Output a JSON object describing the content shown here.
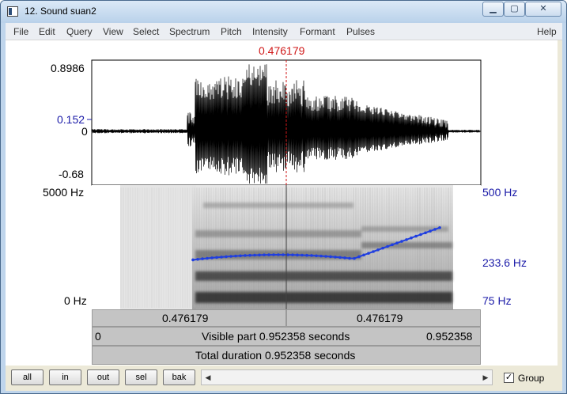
{
  "window": {
    "title": "12. Sound suan2"
  },
  "menu": [
    "File",
    "Edit",
    "Query",
    "View",
    "Select",
    "Spectrum",
    "Pitch",
    "Intensity",
    "Formant",
    "Pulses",
    "Help"
  ],
  "cursor": {
    "time_label": "0.476179",
    "time": 0.476179
  },
  "waveform": {
    "y_max": "0.8986",
    "y_zero": "0",
    "y_min": "-0.68",
    "y_marker": "0.152"
  },
  "spectrogram": {
    "freq_top": "5000 Hz",
    "freq_bottom": "0 Hz"
  },
  "pitch": {
    "top": "500 Hz",
    "current": "233.6 Hz",
    "bottom": "75 Hz"
  },
  "bars": {
    "left_segment": "0.476179",
    "right_segment": "0.476179",
    "visible_start": "0",
    "visible_label": "Visible part 0.952358 seconds",
    "visible_end": "0.952358",
    "total_label": "Total duration 0.952358 seconds"
  },
  "buttons": {
    "all": "all",
    "in": "in",
    "out": "out",
    "sel": "sel",
    "bak": "bak"
  },
  "group": {
    "label": "Group",
    "checked": true
  },
  "colors": {
    "cursor": "#d01818",
    "pitch": "#1f3ee0",
    "axis_labels": "#1a1aa8"
  }
}
